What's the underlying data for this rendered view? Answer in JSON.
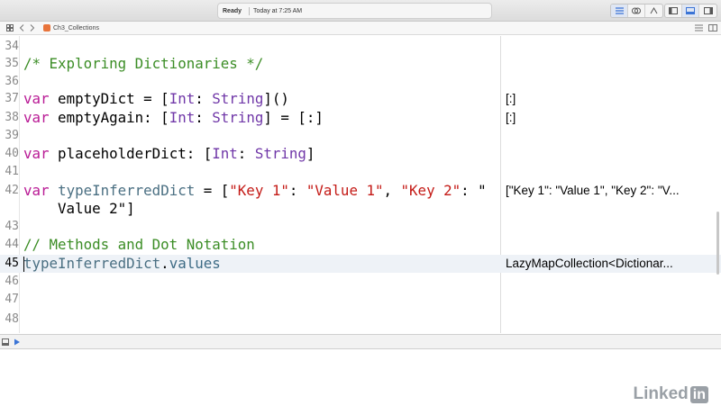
{
  "titlebar": {
    "status": "Ready",
    "timestamp": "Today at 7:25 AM"
  },
  "jumpbar": {
    "file": "Ch3_Collections"
  },
  "editor": {
    "lines": [
      {
        "n": "34",
        "code": "",
        "result": ""
      },
      {
        "n": "35",
        "code": "/* Exploring Dictionaries */",
        "result": ""
      },
      {
        "n": "36",
        "code": "",
        "result": ""
      },
      {
        "n": "37",
        "code": "var emptyDict = [Int: String]()",
        "result": "[:]"
      },
      {
        "n": "38",
        "code": "var emptyAgain: [Int: String] = [:]",
        "result": "[:]"
      },
      {
        "n": "39",
        "code": "",
        "result": ""
      },
      {
        "n": "40",
        "code": "var placeholderDict: [Int: String]",
        "result": ""
      },
      {
        "n": "41",
        "code": "",
        "result": ""
      },
      {
        "n": "42",
        "code": "var typeInferredDict = [\"Key 1\": \"Value 1\", \"Key 2\": \"Value 2\"]",
        "result": "[\"Key 1\": \"Value 1\", \"Key 2\": \"V..."
      },
      {
        "n": "43",
        "code": "",
        "result": ""
      },
      {
        "n": "44",
        "code": "// Methods and Dot Notation",
        "result": ""
      },
      {
        "n": "45",
        "code": "typeInferredDict.values",
        "result": "LazyMapCollection<Dictionar..."
      },
      {
        "n": "46",
        "code": "",
        "result": ""
      },
      {
        "n": "47",
        "code": "",
        "result": ""
      },
      {
        "n": "48",
        "code": "",
        "result": ""
      }
    ]
  },
  "watermark": {
    "brand": "Linked",
    "brand_in": "in"
  },
  "colors": {
    "keyword": "#b91a95",
    "type": "#7037a8",
    "string": "#c41a16",
    "comment": "#3b8d25"
  }
}
